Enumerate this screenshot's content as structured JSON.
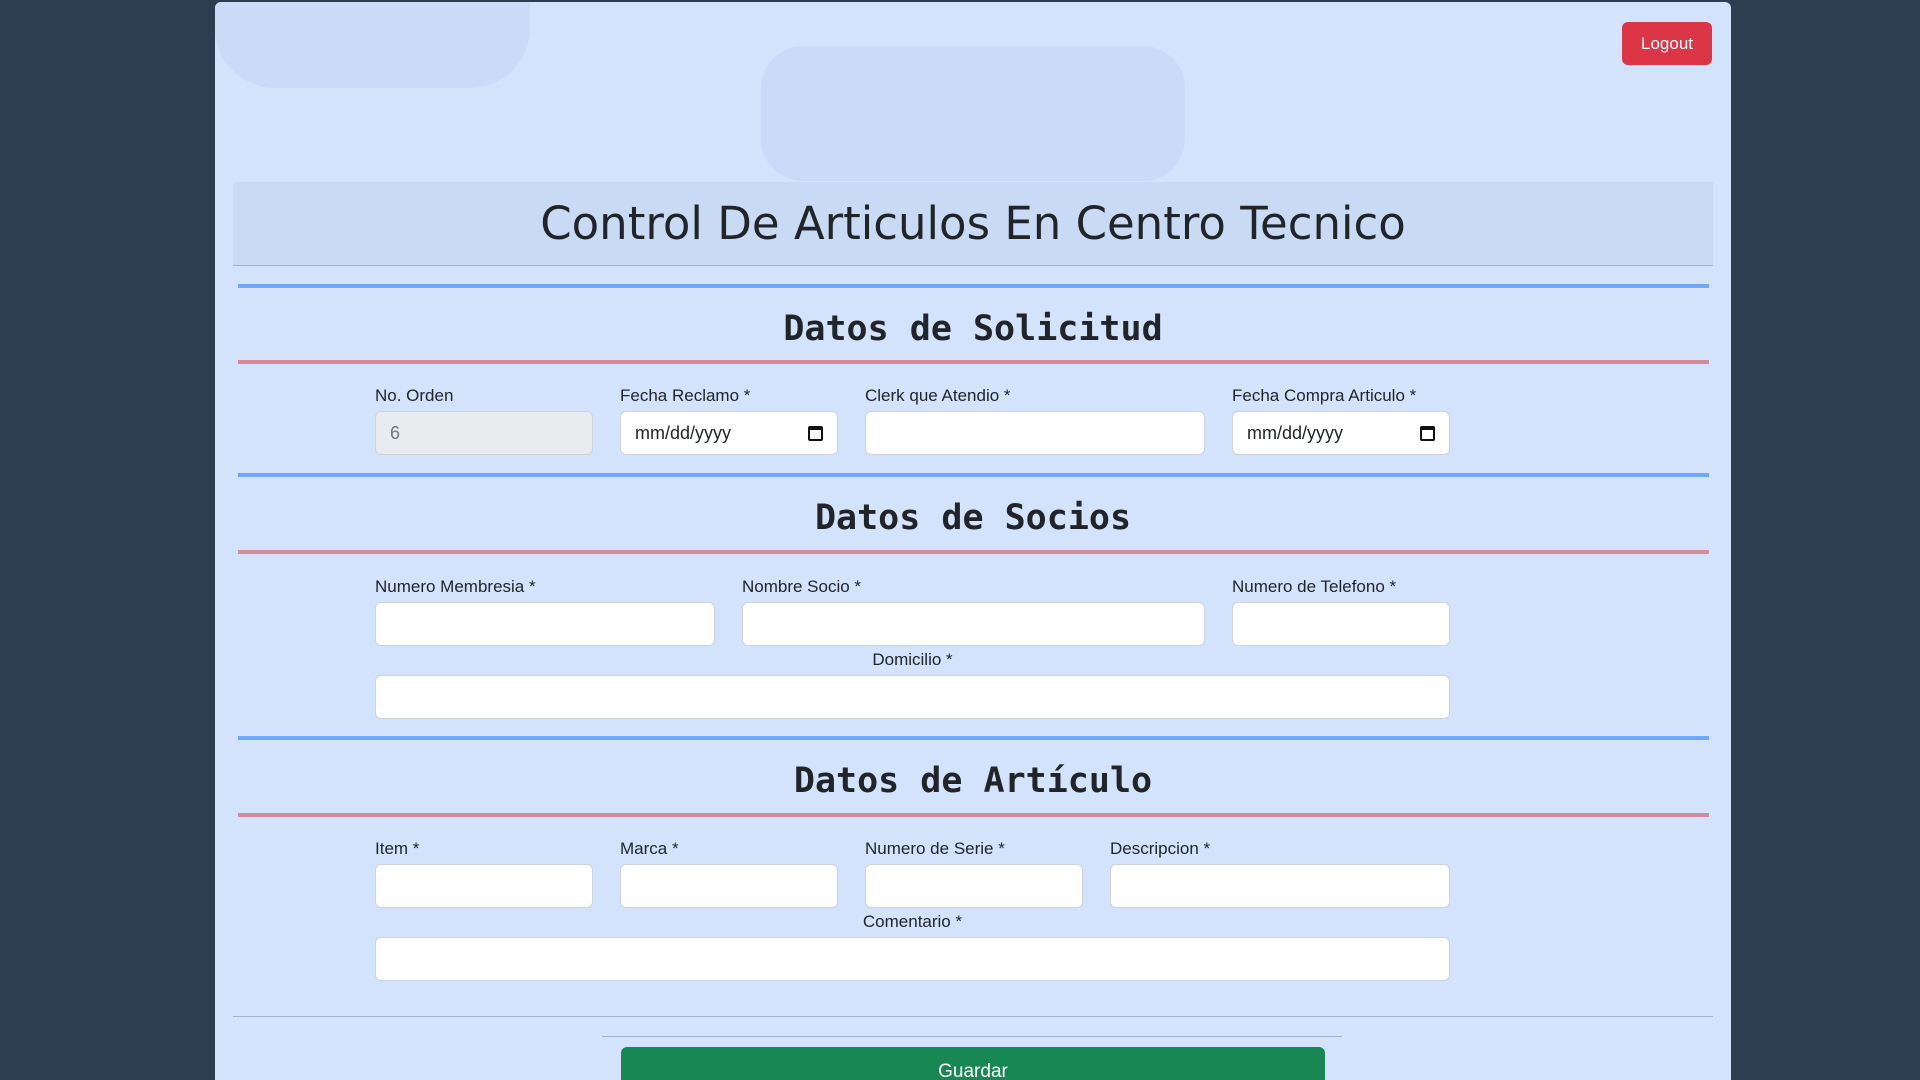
{
  "header": {
    "logout_label": "Logout",
    "title": "Control De Articulos En Centro Tecnico"
  },
  "sections": {
    "solicitud": {
      "title": "Datos de Solicitud",
      "no_orden": {
        "label": "No. Orden",
        "value": "6"
      },
      "fecha_reclamo": {
        "label": "Fecha Reclamo *",
        "placeholder": "mm/dd/yyyy"
      },
      "clerk": {
        "label": "Clerk que Atendio *",
        "value": ""
      },
      "fecha_compra": {
        "label": "Fecha Compra Articulo *",
        "placeholder": "mm/dd/yyyy"
      }
    },
    "socios": {
      "title": "Datos de Socios",
      "membresia": {
        "label": "Numero Membresia *",
        "value": ""
      },
      "nombre": {
        "label": "Nombre Socio *",
        "value": ""
      },
      "telefono": {
        "label": "Numero de Telefono *",
        "value": ""
      },
      "domicilio": {
        "label": "Domicilio *",
        "value": ""
      }
    },
    "articulo": {
      "title": "Datos de Artículo",
      "item": {
        "label": "Item *",
        "value": ""
      },
      "marca": {
        "label": "Marca *",
        "value": ""
      },
      "serie": {
        "label": "Numero de Serie *",
        "value": ""
      },
      "descripcion": {
        "label": "Descripcion *",
        "value": ""
      },
      "comentario": {
        "label": "Comentario *",
        "value": ""
      }
    }
  },
  "footer": {
    "save_label": "Guardar"
  },
  "colors": {
    "background": "#2c3e50",
    "panel": "#d3e3fc",
    "logout": "#dc3545",
    "save": "#198754",
    "divider_blue": "#6ea8fe",
    "divider_pink": "#d58a9a"
  },
  "icons": {
    "date_picker": "calendar-icon"
  }
}
